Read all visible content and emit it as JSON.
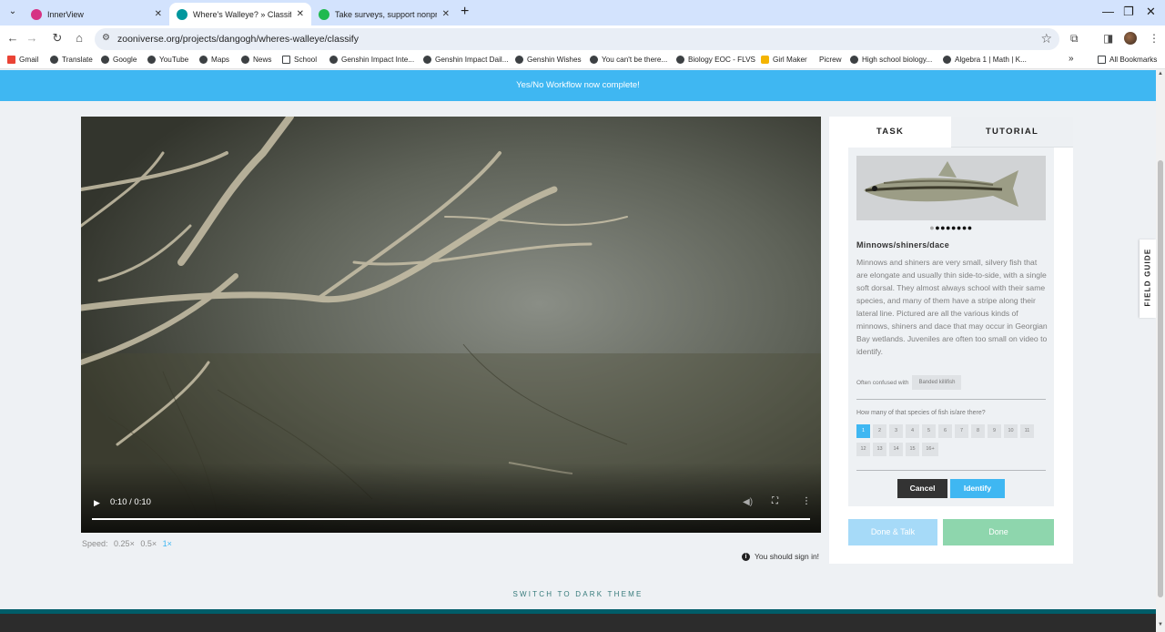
{
  "browser": {
    "tabs": [
      {
        "title": "InnerView",
        "favicon_color": "#d63384",
        "active": false
      },
      {
        "title": "Where's Walleye? » Classify — Zooniverse",
        "favicon_color": "#00979d",
        "active": true
      },
      {
        "title": "Take surveys, support nonprofits",
        "favicon_color": "#1fb94f",
        "active": false
      }
    ],
    "url": "zooniverse.org/projects/dangogh/wheres-walleye/classify",
    "bookmarks": [
      "Gmail",
      "Translate",
      "Google",
      "YouTube",
      "Maps",
      "News",
      "School",
      "Genshin Impact Inte...",
      "Genshin Impact Dail...",
      "Genshin Wishes",
      "You can't be there...",
      "Biology EOC - FLVS",
      "Girl Maker",
      "Picrew",
      "High school biology...",
      "Algebra 1 | Math | K..."
    ],
    "all_bookmarks": "All Bookmarks",
    "overflow": "»"
  },
  "banner": {
    "text": "Yes/No Workflow now complete!"
  },
  "video": {
    "time": "0:10 / 0:10",
    "progress": 1.0
  },
  "speed": {
    "label": "Speed:",
    "options": [
      "0.25×",
      "0.5×",
      "1×"
    ],
    "current": "1×"
  },
  "signin_notice": "You should sign in!",
  "panel": {
    "tabs": {
      "task": "TASK",
      "tutorial": "TUTORIAL"
    },
    "image_dots": "●●●●●●●",
    "species_name": "Minnows/shiners/dace",
    "description": "Minnows and shiners are very small, silvery fish that are elongate and usually thin side-to-side, with a single soft dorsal. They almost always school with their same species, and many of them have a stripe along their lateral line. Pictured are all the various kinds of minnows, shiners and dace that may occur in Georgian Bay wetlands. Juveniles are often too small on video to identify.",
    "confused_label": "Often confused with",
    "confused_with": "Banded killifish",
    "question": "How many of that species of fish is/are there?",
    "counts": [
      "1",
      "2",
      "3",
      "4",
      "5",
      "6",
      "7",
      "8",
      "9",
      "10",
      "11",
      "12",
      "13",
      "14",
      "15",
      "16+"
    ],
    "selected_count": "1",
    "cancel": "Cancel",
    "identify": "Identify",
    "done_talk": "Done & Talk",
    "done": "Done"
  },
  "field_guide": "FIELD GUIDE",
  "dark_theme": "SWITCH TO DARK THEME",
  "colors": {
    "accent": "#3fb7f2",
    "done": "#8ed6ad",
    "footer": "#005d69"
  }
}
